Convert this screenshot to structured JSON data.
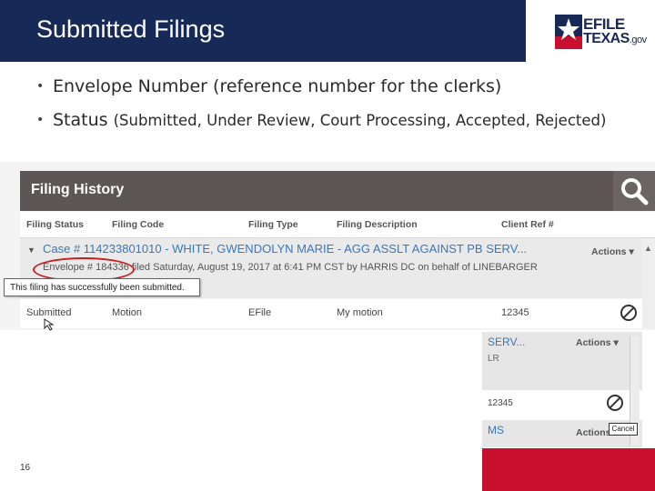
{
  "slide": {
    "title": "Submitted Filings",
    "page_number": "16",
    "colors": {
      "navy": "#172a57",
      "red": "#c8102e",
      "link_blue": "#3a78b8"
    }
  },
  "logo": {
    "line1": "EFILE",
    "line2": "TEXAS",
    "suffix": ".gov"
  },
  "bullets": [
    {
      "text": "Envelope Number (reference number for the clerks)"
    },
    {
      "lead": "Status",
      "detail": "(Submitted, Under Review, Court Processing, Accepted, Rejected)"
    }
  ],
  "filing_history": {
    "title": "Filing History",
    "search_icon": "search-icon",
    "columns": [
      "Filing Status",
      "Filing Code",
      "Filing Type",
      "Filing Description",
      "Client Ref #"
    ],
    "case": {
      "title": "Case # 114233801010 - WHITE, GWENDOLYN MARIE - AGG ASSLT AGAINST PB SERV...",
      "envelope_line": "Envelope # 184336 filed Saturday, August 19, 2017 at 6:41 PM CST by HARRIS DC on behalf of LINEBARGER",
      "actions_label": "Actions"
    },
    "tooltip": "This filing has successfully been submitted.",
    "row": {
      "status": "Submitted",
      "code": "Motion",
      "type": "EFile",
      "description": "My motion",
      "client_ref": "12345"
    }
  },
  "lower_shot": {
    "case_suffix": "SERV...",
    "actions_label": "Actions",
    "line2": "LR",
    "client_ref": "12345",
    "cancel_label": "Cancel",
    "row3_text": "MS",
    "actions_label_2": "Actions"
  }
}
